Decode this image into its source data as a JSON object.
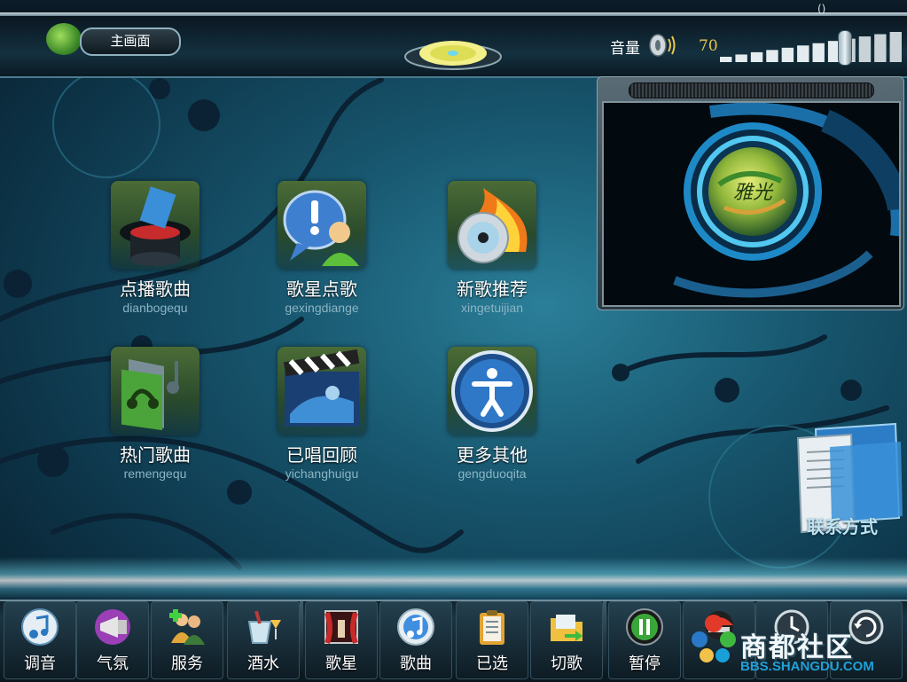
{
  "header": {
    "home_button": "主画面",
    "volume_label": "音量",
    "volume_value": "70",
    "volume_level": 0.7,
    "top_marker": "()"
  },
  "menu": [
    {
      "label": "点播歌曲",
      "pinyin": "dianbogequ",
      "icon": "magic-hat-icon"
    },
    {
      "label": "歌星点歌",
      "pinyin": "gexingdiange",
      "icon": "chat-user-icon"
    },
    {
      "label": "新歌推荐",
      "pinyin": "xingetuijian",
      "icon": "flaming-disc-icon"
    },
    {
      "label": "热门歌曲",
      "pinyin": "remengequ",
      "icon": "music-headphones-icon"
    },
    {
      "label": "已唱回顾",
      "pinyin": "yichanghuigu",
      "icon": "clapperboard-icon"
    },
    {
      "label": "更多其他",
      "pinyin": "gengduoqita",
      "icon": "accessibility-person-icon"
    }
  ],
  "preview": {
    "logo_text": "雅光"
  },
  "contact": {
    "label": "联系方式"
  },
  "bottom_bar": [
    {
      "label": "调音",
      "icon": "music-note-icon"
    },
    {
      "label": "气氛",
      "icon": "megaphone-icon"
    },
    {
      "label": "服务",
      "icon": "staff-icon"
    },
    {
      "label": "酒水",
      "icon": "drinks-icon"
    },
    {
      "label": "歌星",
      "icon": "stage-icon"
    },
    {
      "label": "歌曲",
      "icon": "itunes-icon"
    },
    {
      "label": "已选",
      "icon": "clipboard-icon"
    },
    {
      "label": "切歌",
      "icon": "folder-arrow-icon"
    },
    {
      "label": "暂停",
      "icon": "pause-icon"
    },
    {
      "label": "",
      "icon": "helmet-icon"
    },
    {
      "label": "",
      "icon": "clock-icon"
    },
    {
      "label": "",
      "icon": "refresh-icon"
    }
  ],
  "watermark": {
    "main": "商都社区",
    "sub": "BBS.SHANGDU.COM"
  },
  "colors": {
    "volume_value": "#e6c84d",
    "pinyin": "#8bb4c4",
    "watermark_sub": "#1fa0d8"
  }
}
